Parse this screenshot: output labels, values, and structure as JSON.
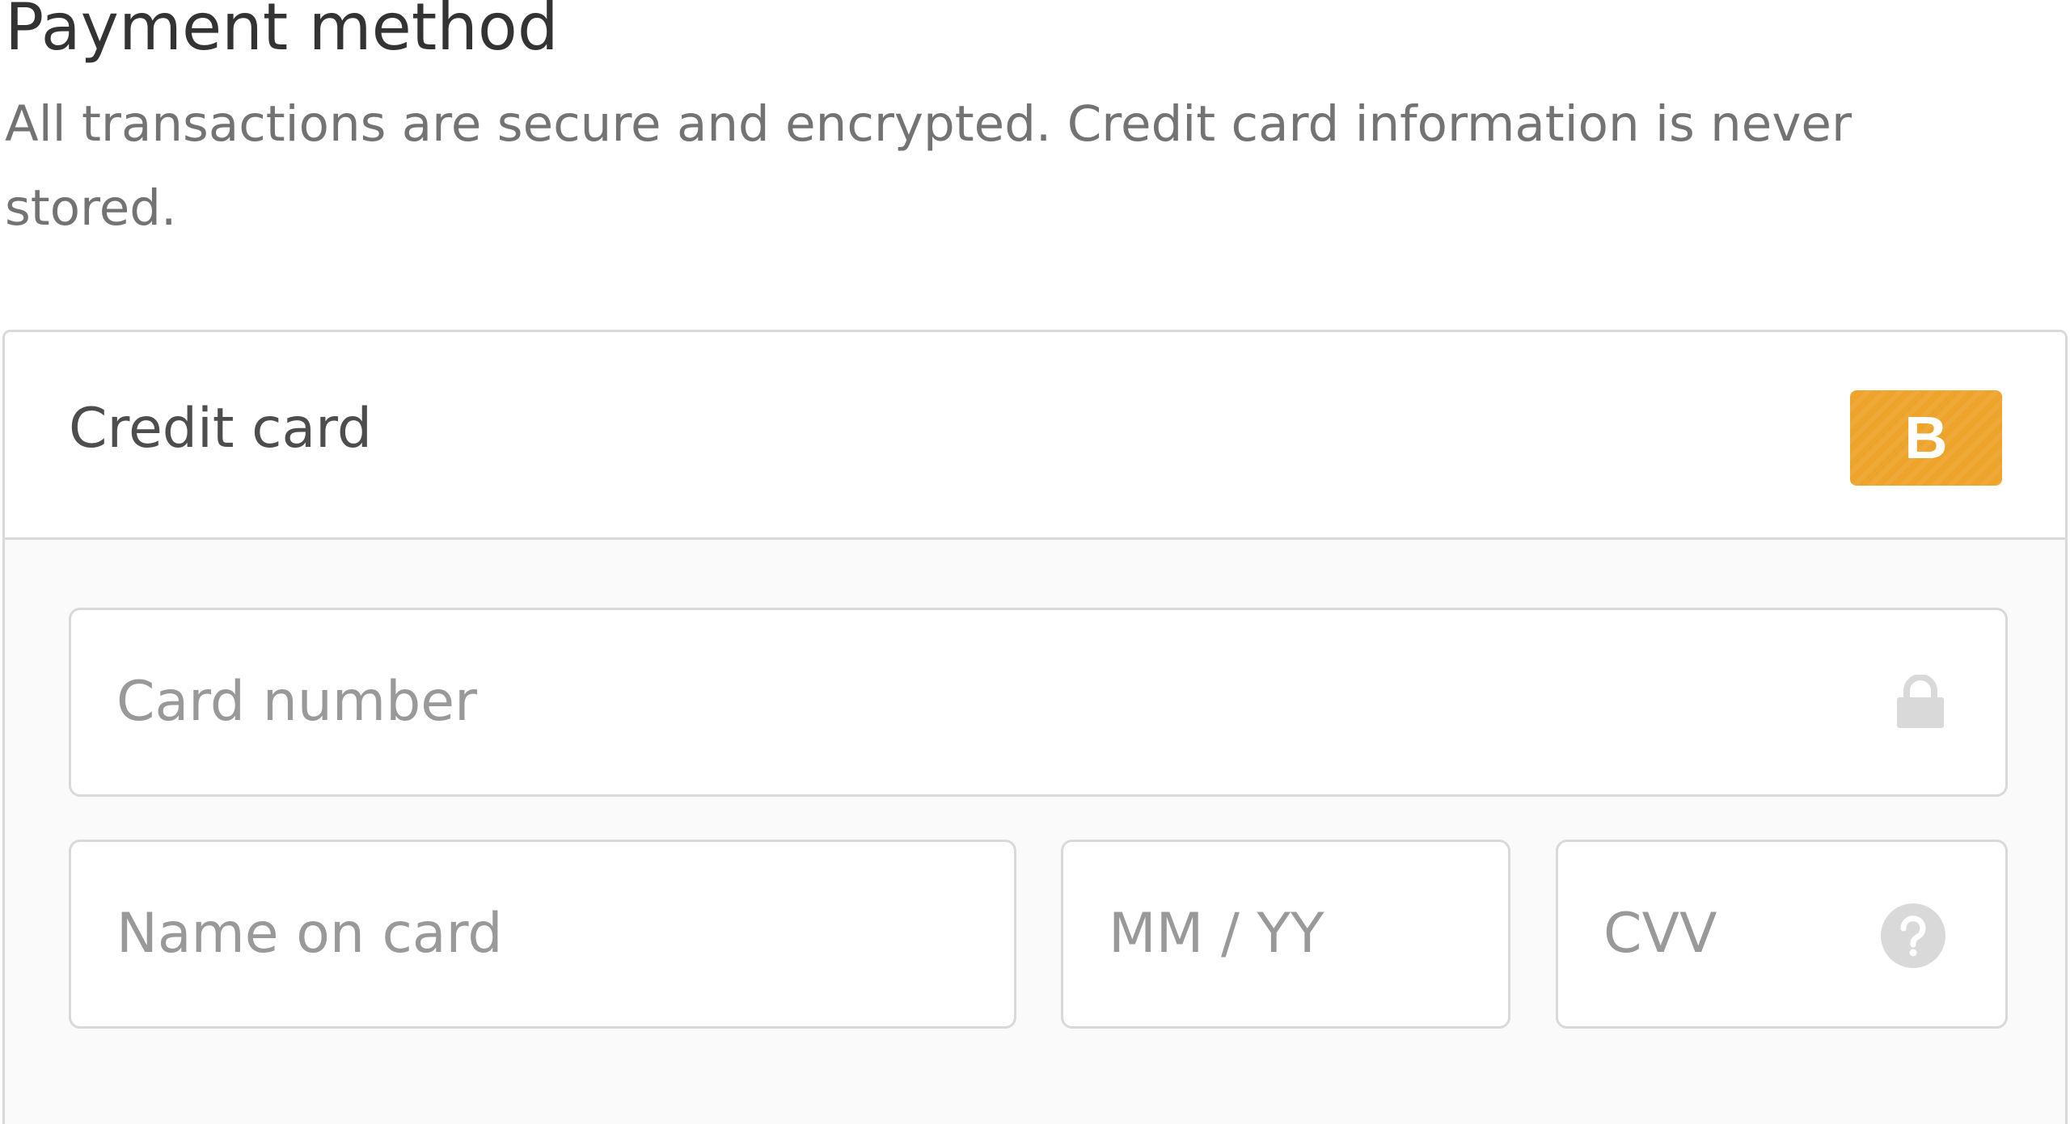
{
  "heading": {
    "title": "Payment method",
    "description": "All transactions are secure and encrypted. Credit card information is never stored."
  },
  "payment_option": {
    "label": "Credit card",
    "badge_text": "B",
    "badge_color": "#eea32a"
  },
  "fields": {
    "card_number": {
      "placeholder": "Card number",
      "icon": "lock-icon"
    },
    "name_on_card": {
      "placeholder": "Name on card"
    },
    "expiry": {
      "placeholder": "MM / YY"
    },
    "cvv": {
      "placeholder": "CVV",
      "icon": "help-icon"
    }
  },
  "colors": {
    "title_text": "#333333",
    "secondary_text": "#737373",
    "placeholder_text": "#999999",
    "border": "#d9d9d9",
    "panel_background": "#fafafa",
    "icon": "#d9d9d9"
  }
}
